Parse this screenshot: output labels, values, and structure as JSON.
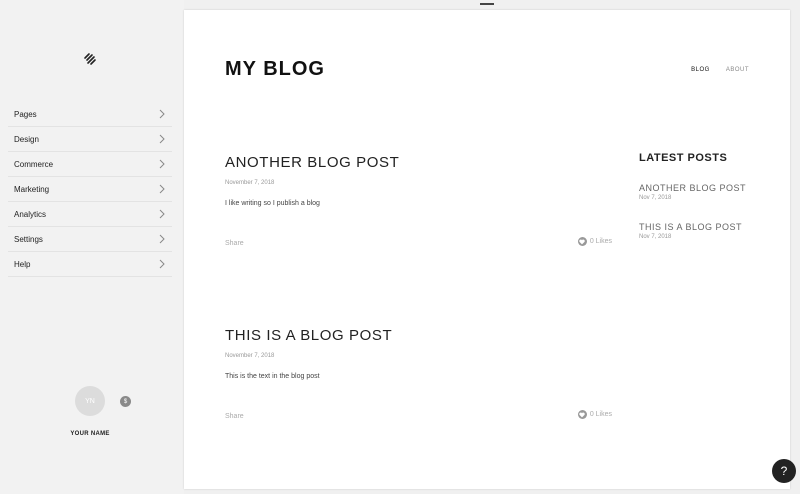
{
  "sidebar": {
    "items": [
      {
        "label": "Pages"
      },
      {
        "label": "Design"
      },
      {
        "label": "Commerce"
      },
      {
        "label": "Marketing"
      },
      {
        "label": "Analytics"
      },
      {
        "label": "Settings"
      },
      {
        "label": "Help"
      }
    ],
    "profile": {
      "initials": "YN",
      "name": "YOUR NAME",
      "badge": "$"
    }
  },
  "site": {
    "title": "MY BLOG",
    "nav": [
      {
        "label": "BLOG",
        "active": true
      },
      {
        "label": "ABOUT",
        "active": false
      }
    ]
  },
  "posts": [
    {
      "title": "ANOTHER BLOG POST",
      "date": "November 7, 2018",
      "body": "I like writing so I publish a blog",
      "share": "Share",
      "likes": "0 Likes"
    },
    {
      "title": "THIS IS A BLOG POST",
      "date": "November 7, 2018",
      "body": "This is the text in the blog post",
      "share": "Share",
      "likes": "0 Likes"
    }
  ],
  "aside": {
    "title": "LATEST POSTS",
    "items": [
      {
        "title": "ANOTHER BLOG POST",
        "date": "Nov 7, 2018"
      },
      {
        "title": "THIS IS A BLOG POST",
        "date": "Nov 7, 2018"
      }
    ]
  },
  "help": {
    "label": "?"
  },
  "colors": {
    "sidebar_bg": "#f2f2f2",
    "text_dark": "#222222",
    "text_muted": "#999999",
    "help_bg": "#222222"
  }
}
